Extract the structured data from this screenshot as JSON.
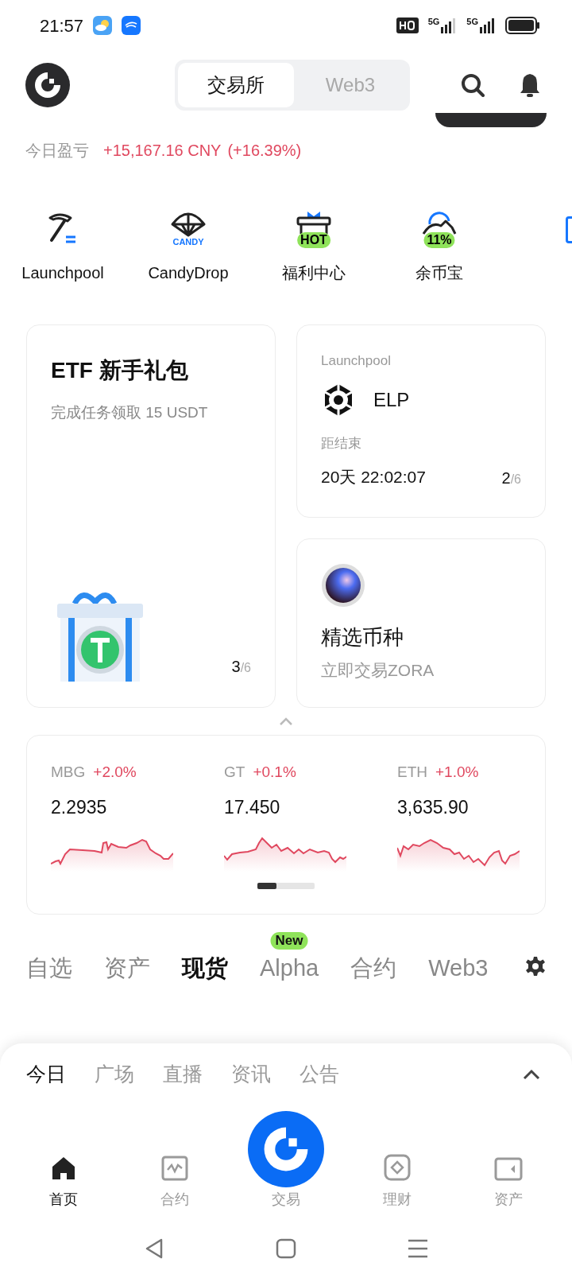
{
  "status_bar": {
    "time": "21:57",
    "signals": [
      "5G",
      "5G"
    ]
  },
  "header": {
    "segments": [
      {
        "label": "交易所",
        "selected": true
      },
      {
        "label": "Web3",
        "selected": false
      }
    ]
  },
  "pnl": {
    "label": "今日盈亏",
    "value": "+15,167.16 CNY",
    "percent": "(+16.39%)"
  },
  "shortcuts": [
    {
      "kind": "pickaxe",
      "label": "Launchpool"
    },
    {
      "kind": "parachute",
      "label": "CandyDrop",
      "badge": "CANDY"
    },
    {
      "kind": "gift",
      "label": "福利中心",
      "badge": "HOT"
    },
    {
      "kind": "mountain",
      "label": "余币宝",
      "badge": "11%"
    }
  ],
  "promo": {
    "title": "ETF 新手礼包",
    "subtitle": "完成任务领取 15 USDT",
    "page": "3",
    "total": "/6"
  },
  "launchpool": {
    "label": "Launchpool",
    "token": "ELP",
    "countdown_label": "距结束",
    "countdown": "20天 22:02:07",
    "page": "2",
    "total": "/6"
  },
  "featured": {
    "title": "精选币种",
    "subtitle": "立即交易ZORA"
  },
  "markets": [
    {
      "symbol": "MBG",
      "change": "+2.0%",
      "price": "2.2935"
    },
    {
      "symbol": "GT",
      "change": "+0.1%",
      "price": "17.450"
    },
    {
      "symbol": "ETH",
      "change": "+1.0%",
      "price": "3,635.90"
    }
  ],
  "market_tabs": [
    {
      "label": "自选",
      "selected": false
    },
    {
      "label": "资产",
      "selected": false
    },
    {
      "label": "现货",
      "selected": true
    },
    {
      "label": "Alpha",
      "selected": false,
      "badge": "New"
    },
    {
      "label": "合约",
      "selected": false
    },
    {
      "label": "Web3",
      "selected": false
    }
  ],
  "sheet_tabs": [
    {
      "label": "今日",
      "selected": true
    },
    {
      "label": "广场",
      "selected": false
    },
    {
      "label": "直播",
      "selected": false
    },
    {
      "label": "资讯",
      "selected": false
    },
    {
      "label": "公告",
      "selected": false
    }
  ],
  "nav": [
    {
      "kind": "home",
      "label": "首页",
      "selected": true
    },
    {
      "kind": "chart",
      "label": "合约",
      "selected": false
    },
    {
      "kind": "trade",
      "label": "交易",
      "selected": false
    },
    {
      "kind": "finance",
      "label": "理财",
      "selected": false
    },
    {
      "kind": "wallet",
      "label": "资产",
      "selected": false
    }
  ]
}
